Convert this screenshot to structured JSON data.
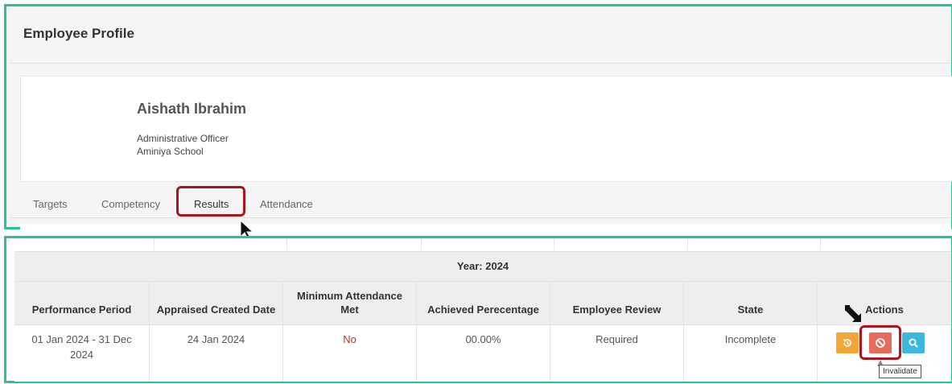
{
  "header": {
    "title": "Employee Profile"
  },
  "employee": {
    "name": "Aishath Ibrahim",
    "position": "Administrative Officer",
    "school": "Aminiya School"
  },
  "tabs": [
    {
      "label": "Targets"
    },
    {
      "label": "Competency"
    },
    {
      "label": "Results",
      "active": true
    },
    {
      "label": "Attendance"
    }
  ],
  "results": {
    "year_label": "Year: 2024",
    "columns": [
      "Performance Period",
      "Appraised Created Date",
      "Minimum Attendance Met",
      "Achieved Perecentage",
      "Employee Review",
      "State",
      "Actions"
    ],
    "rows": [
      {
        "period": "01 Jan 2024 - 31 Dec 2024",
        "created": "24 Jan 2024",
        "attendance_met": "No",
        "percentage": "00.00%",
        "review": "Required",
        "state": "Incomplete"
      }
    ],
    "actions": [
      {
        "icon": "history-icon",
        "color": "#f2a63a"
      },
      {
        "icon": "ban-icon",
        "color": "#e66b5d",
        "tooltip": "Invalidate"
      },
      {
        "icon": "search-icon",
        "color": "#3cb7df"
      }
    ]
  },
  "colors": {
    "frame": "#2bc48f",
    "highlight": "#a8161e",
    "negative_text": "#b5332a"
  }
}
